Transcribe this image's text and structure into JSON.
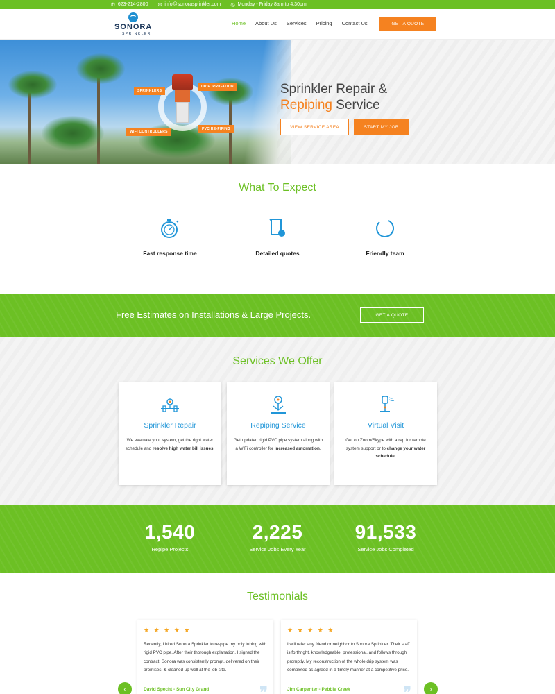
{
  "topbar": {
    "phone": "623-214-2800",
    "email": "info@sonorasprinkler.com",
    "hours": "Monday - Friday 8am to 4:30pm"
  },
  "header": {
    "logo_name": "SONORA",
    "logo_sub": "SPRINKLER",
    "nav": [
      "Home",
      "About Us",
      "Services",
      "Pricing",
      "Contact Us"
    ],
    "active_nav": "Home",
    "quote_label": "GET A QUOTE"
  },
  "hero": {
    "title_line1": "Sprinkler Repair &",
    "title_line2_orange": "Repiping",
    "title_line2_rest": " Service",
    "btn_view": "VIEW SERVICE AREA",
    "btn_start": "START MY JOB",
    "tags": [
      "SPRINKLERS",
      "DRIP IRRIGATION",
      "WIFI CONTROLLERS",
      "PVC RE-PIPING"
    ]
  },
  "expect": {
    "title": "What To Expect",
    "items": [
      "Fast response time",
      "Detailed quotes",
      "Friendly team"
    ]
  },
  "band": {
    "text": "Free Estimates on Installations & Large Projects.",
    "btn": "GET A QUOTE"
  },
  "services": {
    "title": "Services We Offer",
    "cards": [
      {
        "title": "Sprinkler Repair",
        "desc_a": "We evaluate your system, get the right water schedule and ",
        "desc_b": "resolve high water bill issues",
        "desc_c": "!"
      },
      {
        "title": "Repiping Service",
        "desc_a": "Get updated rigid PVC pipe system along with a WiFi controller for ",
        "desc_b": "increased automation",
        "desc_c": "."
      },
      {
        "title": "Virtual Visit",
        "desc_a": "Get on Zoom/Skype with a rep for remote system support or to ",
        "desc_b": "change your water schedule",
        "desc_c": "."
      }
    ]
  },
  "stats": [
    {
      "num": "1,540",
      "label": "Repipe Projects"
    },
    {
      "num": "2,225",
      "label": "Service Jobs Every Year"
    },
    {
      "num": "91,533",
      "label": "Service Jobs Completed"
    }
  ],
  "testimonials": {
    "title": "Testimonials",
    "stars": "★ ★ ★ ★ ★",
    "items": [
      {
        "text": "Recently, I hired Sonora Sprinkler to re-pipe my poly tubing with rigid PVC pipe. After their thorough explanation, I signed the contract. Sonora was consistently prompt, delivered on their promises, & cleaned up well at the job site.",
        "author": "David Specht - Sun City Grand"
      },
      {
        "text": "I will refer any friend or neighbor to Sonora Sprinkler. Their staff is forthright, knowledgeable, professional, and follows through promptly. My reconstruction of the whole drip system was completed as agreed in a timely manner at a competitive price.",
        "author": "Jim Carpenter - Pebble Creek"
      }
    ],
    "prev": "‹",
    "next": "›"
  },
  "colors": {
    "green": "#6cc024",
    "orange": "#f58220",
    "blue": "#2196d8"
  }
}
